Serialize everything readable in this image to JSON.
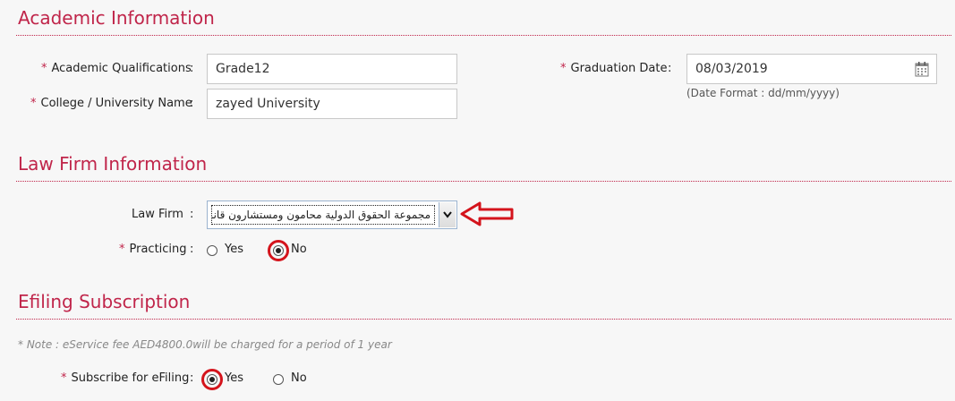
{
  "academic": {
    "title": "Academic Information",
    "qualifications_label": "Academic Qualifications",
    "qualifications_value": "Grade12",
    "university_label": "College / University Name",
    "university_value": "zayed University",
    "graduation_label": "Graduation Date",
    "graduation_value": "08/03/2019",
    "date_hint": "(Date Format : dd/mm/yyyy)"
  },
  "law_firm": {
    "title": "Law Firm Information",
    "firm_label": "Law Firm",
    "firm_selected": "مجموعة الحقوق الدولية محامون ومستشارون قانونيون",
    "practicing_label": "Practicing",
    "practicing_options": [
      "Yes",
      "No"
    ],
    "practicing_selected": "No"
  },
  "efiling": {
    "title": "Efiling Subscription",
    "note": "* Note : eService fee AED4800.0will be charged for a period of 1 year",
    "subscribe_label": "Subscribe for eFiling",
    "subscribe_options": [
      "Yes",
      "No"
    ],
    "subscribe_selected": "Yes"
  },
  "common": {
    "required_mark": "*",
    "colon": ":"
  },
  "colors": {
    "accent": "#c0254a",
    "annotation": "#d4141c"
  },
  "icons": {
    "calendar": "calendar-icon",
    "dropdown": "chevron-down-icon",
    "annotation_arrow": "left-arrow-icon"
  }
}
